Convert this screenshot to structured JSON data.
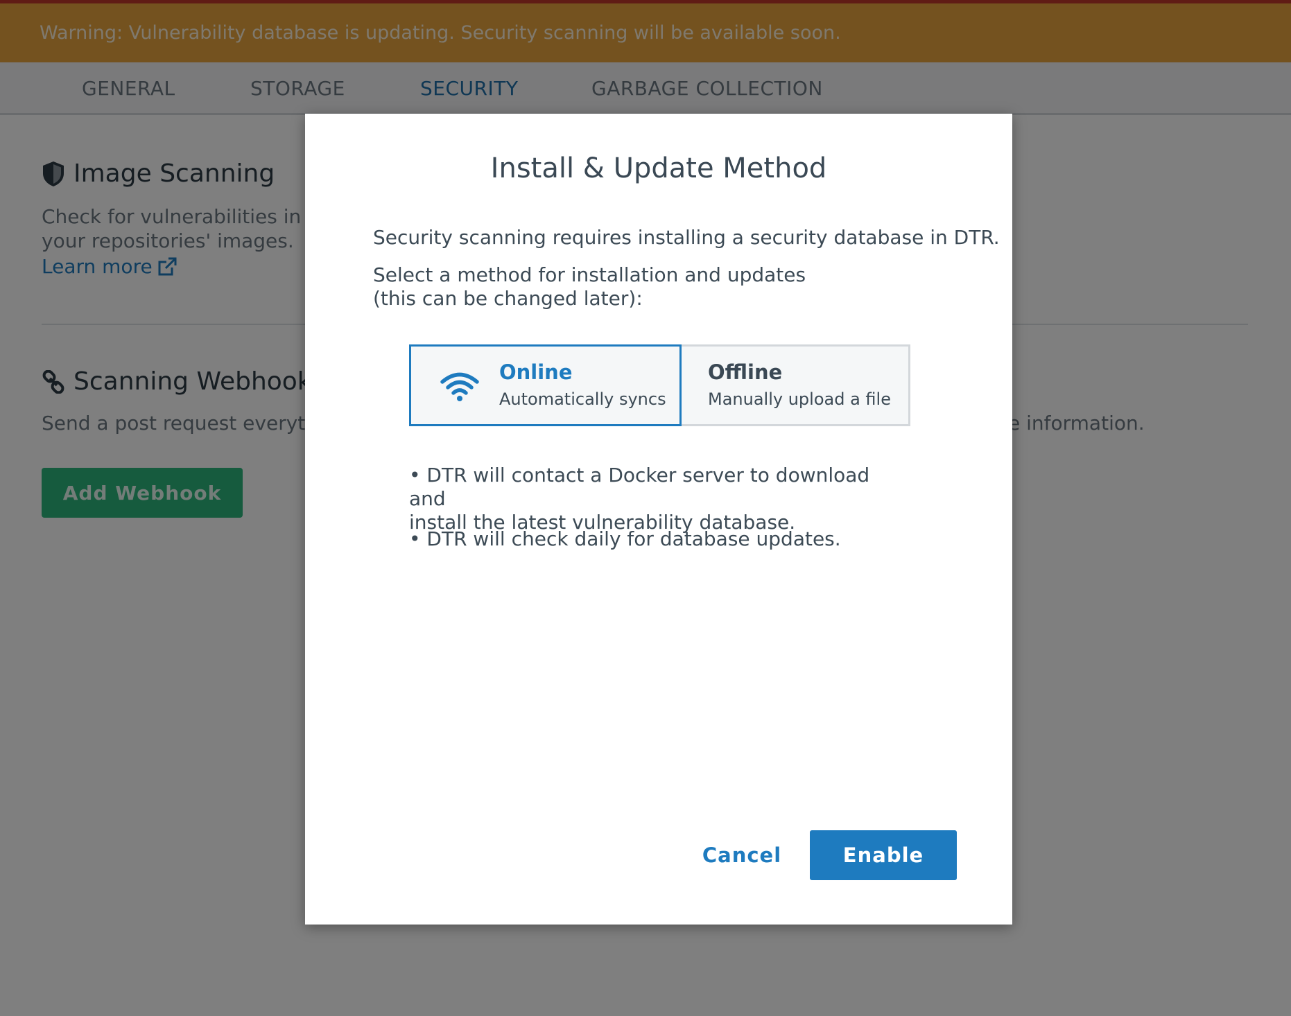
{
  "warning": {
    "text": "Warning: Vulnerability database is updating. Security scanning will be available soon."
  },
  "tabs": [
    {
      "label": "GENERAL"
    },
    {
      "label": "STORAGE"
    },
    {
      "label": "SECURITY"
    },
    {
      "label": "GARBAGE COLLECTION"
    }
  ],
  "image_scanning": {
    "title": "Image Scanning",
    "description_line1": "Check for vulnerabilities in",
    "description_line2": "your repositories' images.",
    "learn_more": "Learn more"
  },
  "scanning_webhook": {
    "title": "Scanning Webhook",
    "description_visible": "Send a post request everytin",
    "description_right_fragment": "e information.",
    "add_button": "Add Webhook"
  },
  "modal": {
    "title": "Install & Update Method",
    "intro": "Security scanning requires installing a security database in DTR.",
    "select_line1": "Select a method for installation and updates",
    "select_line2": "(this can be changed later):",
    "options": [
      {
        "label": "Online",
        "sublabel": "Automatically syncs",
        "selected": true
      },
      {
        "label": "Offline",
        "sublabel": "Manually upload a file",
        "selected": false
      }
    ],
    "bullets": [
      {
        "line1": "• DTR will contact a Docker server to download and",
        "line2": "install the latest vulnerability database."
      },
      {
        "line1": "• DTR will check daily for database updates."
      }
    ],
    "cancel": "Cancel",
    "enable": "Enable"
  },
  "colors": {
    "warning": "#e9a53e",
    "accent": "#1e7bbf",
    "success": "#2cb67d"
  },
  "icons": {
    "image_scanning": "shield-icon",
    "learn_more": "external-link-icon",
    "webhook": "link-icon",
    "online": "wifi-icon"
  }
}
